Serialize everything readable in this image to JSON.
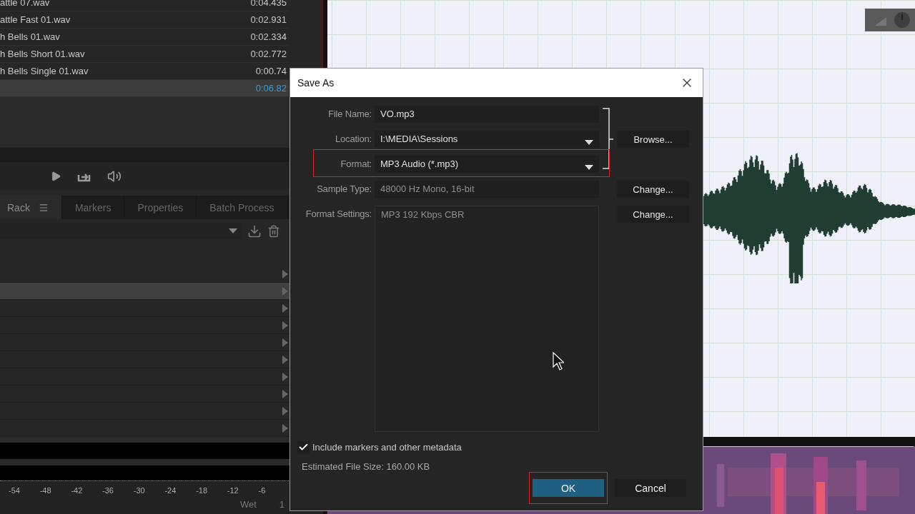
{
  "file_list": {
    "rows": [
      {
        "name": "attle 07.wav",
        "duration": "0:04.435",
        "selected": false
      },
      {
        "name": "attle Fast 01.wav",
        "duration": "0:02.931",
        "selected": false
      },
      {
        "name": "h Bells 01.wav",
        "duration": "0:02.334",
        "selected": false
      },
      {
        "name": "h Bells Short 01.wav",
        "duration": "0:02.772",
        "selected": false
      },
      {
        "name": "h Bells Single 01.wav",
        "duration": "0:00.74",
        "selected": false
      },
      {
        "duration": "0:06.82",
        "selected": true
      }
    ]
  },
  "panel_tabs": [
    {
      "label": "Rack",
      "selected": true,
      "menu": true
    },
    {
      "label": "Markers",
      "selected": false
    },
    {
      "label": "Properties",
      "selected": false
    },
    {
      "label": "Batch Process",
      "selected": false
    }
  ],
  "rack_slots": [
    {
      "selected": false
    },
    {
      "selected": true
    },
    {
      "selected": false
    },
    {
      "selected": false
    },
    {
      "selected": false
    },
    {
      "selected": false
    },
    {
      "selected": false
    },
    {
      "selected": false
    },
    {
      "selected": false
    },
    {
      "selected": false
    }
  ],
  "meter_scale": [
    "-54",
    "-48",
    "-42",
    "-36",
    "-30",
    "-24",
    "-18",
    "-12",
    "-6"
  ],
  "mix": {
    "label": "Wet",
    "value": "1"
  },
  "dialog": {
    "title": "Save As",
    "fields": [
      {
        "label": "File Name:",
        "value": "VO.mp3",
        "kind": "text",
        "highlighted": false
      },
      {
        "label": "Location:",
        "value": "I:\\MEDIA\\Sessions",
        "kind": "dropdown",
        "button": "Browse...",
        "highlighted": false
      },
      {
        "label": "Format:",
        "value": "MP3 Audio (*.mp3)",
        "kind": "dropdown",
        "highlighted": true
      },
      {
        "label": "Sample Type:",
        "value": "48000 Hz Mono, 16-bit",
        "kind": "readonly",
        "button": "Change...",
        "highlighted": false
      },
      {
        "label": "Format Settings:",
        "value": "MP3 192 Kbps CBR",
        "kind": "area",
        "button": "Change...",
        "highlighted": false
      }
    ],
    "checkbox": {
      "label": "Include markers and other metadata",
      "checked": true
    },
    "estimate": "Estimated File Size: 160.00 KB",
    "buttons": [
      {
        "label": "OK",
        "kind": "primary",
        "highlighted": true
      },
      {
        "label": "Cancel",
        "kind": "secondary",
        "highlighted": false
      }
    ]
  }
}
